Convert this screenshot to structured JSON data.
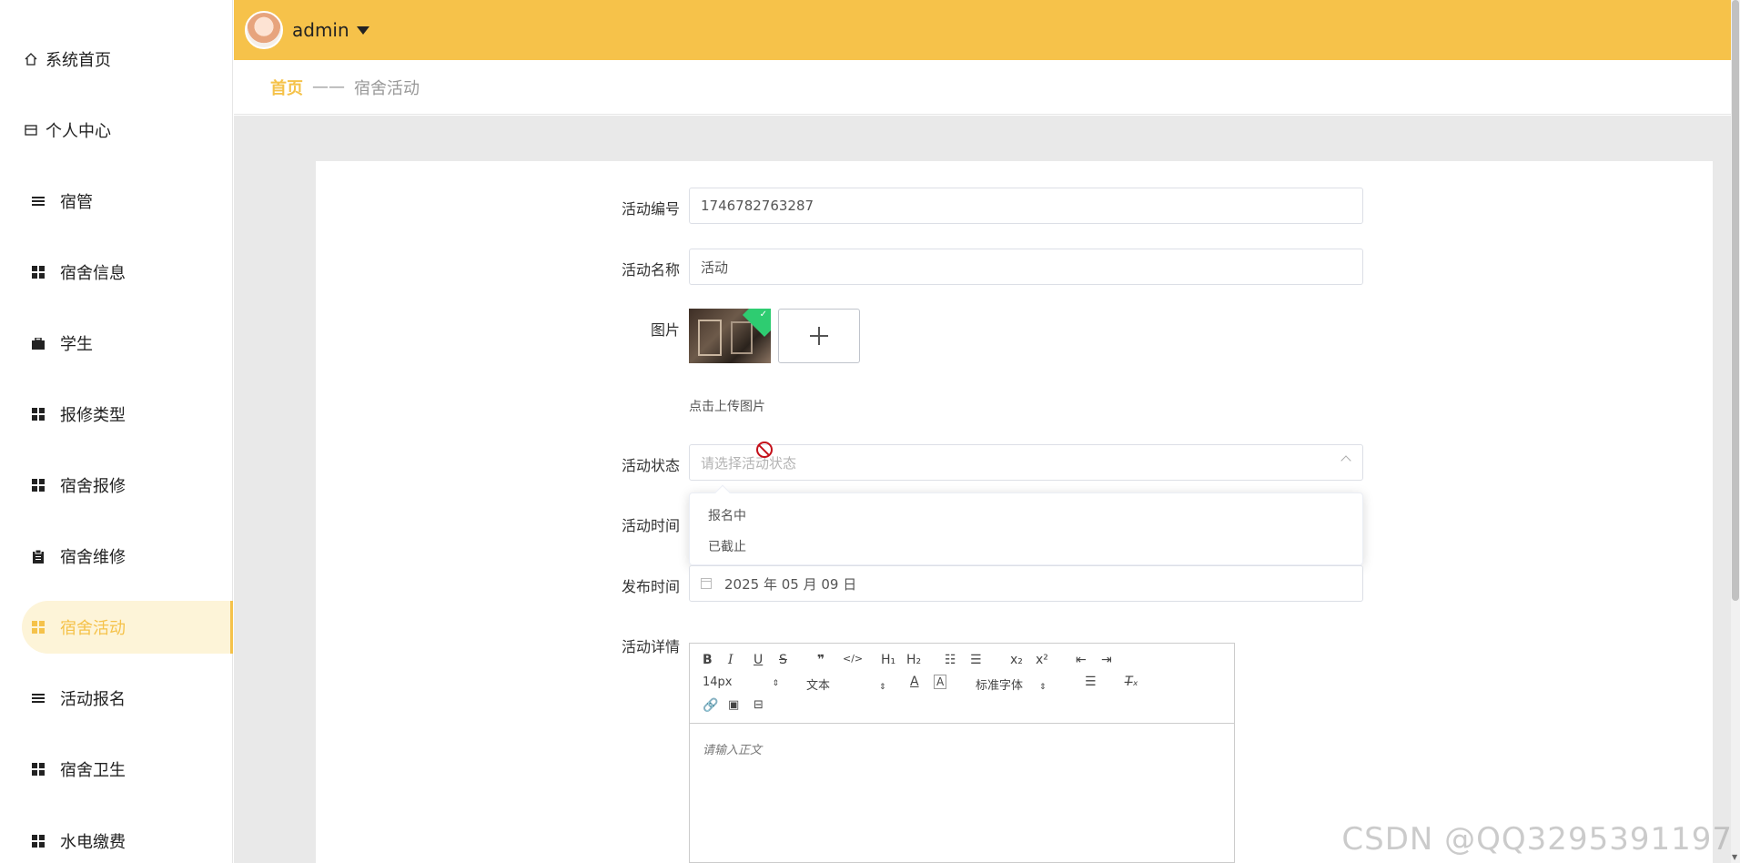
{
  "sidebar": {
    "items": [
      {
        "label": "系统首页",
        "icon": "home-icon"
      },
      {
        "label": "个人中心",
        "icon": "card-icon"
      },
      {
        "label": "宿管",
        "icon": "list-icon"
      },
      {
        "label": "宿舍信息",
        "icon": "grid-icon"
      },
      {
        "label": "学生",
        "icon": "briefcase-icon"
      },
      {
        "label": "报修类型",
        "icon": "grid-icon"
      },
      {
        "label": "宿舍报修",
        "icon": "grid-icon"
      },
      {
        "label": "宿舍维修",
        "icon": "clipboard-icon"
      },
      {
        "label": "宿舍活动",
        "icon": "grid-icon",
        "active": true
      },
      {
        "label": "活动报名",
        "icon": "list-icon"
      },
      {
        "label": "宿舍卫生",
        "icon": "grid-icon"
      },
      {
        "label": "水电缴费",
        "icon": "grid-icon"
      }
    ]
  },
  "topbar": {
    "username": "admin",
    "bg_color": "#f6c24a"
  },
  "breadcrumb": {
    "home": "首页",
    "separator": "——",
    "current": "宿舍活动"
  },
  "form": {
    "activity_no": {
      "label": "活动编号",
      "value": "1746782763287"
    },
    "activity_name": {
      "label": "活动名称",
      "value": "活动"
    },
    "image": {
      "label": "图片",
      "hint": "点击上传图片"
    },
    "status": {
      "label": "活动状态",
      "placeholder": "请选择活动状态",
      "options": [
        "报名中",
        "已截止"
      ]
    },
    "activity_time": {
      "label": "活动时间"
    },
    "publish_time": {
      "label": "发布时间",
      "value": "2025 年 05 月 09 日"
    },
    "detail": {
      "label": "活动详情",
      "placeholder": "请输入正文"
    }
  },
  "editor_toolbar": {
    "row1": [
      "B",
      "I",
      "U",
      "S",
      "99",
      "</>",
      "H1",
      "H2",
      "ol",
      "ul",
      "x2",
      "x2",
      "outdent",
      "indent"
    ],
    "font_size": "14px",
    "text_type": "文本",
    "font_family": "标准字体"
  },
  "watermark": "CSDN @QQ3295391197",
  "accent_color": "#f5c24a"
}
